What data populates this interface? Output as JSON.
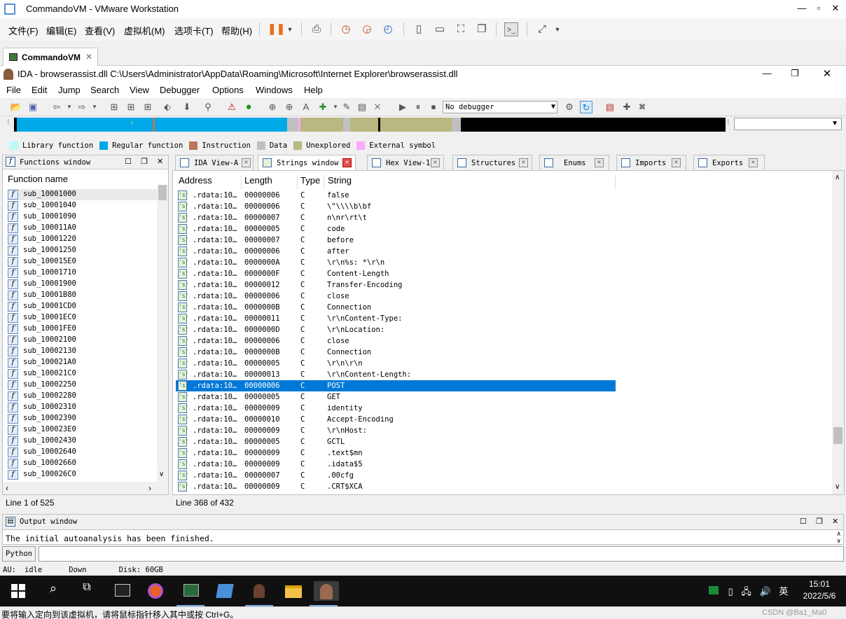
{
  "vmware": {
    "title": "CommandoVM - VMware Workstation",
    "menu": [
      "文件(F)",
      "编辑(E)",
      "查看(V)",
      "虚拟机(M)",
      "选项卡(T)",
      "帮助(H)"
    ],
    "tab": "CommandoVM",
    "status": "要将输入定向到该虚拟机，请将鼠标指针移入其中或按 Ctrl+G。",
    "watermark": "CSDN @Ba1_Ma0"
  },
  "ida": {
    "title": "IDA - browserassist.dll C:\\Users\\Administrator\\AppData\\Roaming\\Microsoft\\Internet Explorer\\browserassist.dll",
    "menu": [
      "File",
      "Edit",
      "Jump",
      "Search",
      "View",
      "Debugger",
      "Options",
      "Windows",
      "Help"
    ],
    "debugger": "No debugger",
    "legend": [
      {
        "label": "Library function",
        "color": "#c0f8f8"
      },
      {
        "label": "Regular function",
        "color": "#00a8e8"
      },
      {
        "label": "Instruction",
        "color": "#b87858"
      },
      {
        "label": "Data",
        "color": "#c0c0c0"
      },
      {
        "label": "Unexplored",
        "color": "#b8b880"
      },
      {
        "label": "External symbol",
        "color": "#ffa8ff"
      }
    ],
    "tabs": [
      "IDA View-A",
      "Strings window",
      "Hex View-1",
      "Structures",
      "Enums",
      "Imports",
      "Exports"
    ],
    "functions": {
      "title": "Functions window",
      "column": "Function name",
      "items": [
        "sub_10001000",
        "sub_10001040",
        "sub_10001090",
        "sub_100011A0",
        "sub_10001220",
        "sub_10001250",
        "sub_100015E0",
        "sub_10001710",
        "sub_10001900",
        "sub_10001B80",
        "sub_10001CD0",
        "sub_10001EC0",
        "sub_10001FE0",
        "sub_10002100",
        "sub_10002130",
        "sub_100021A0",
        "sub_100021C0",
        "sub_10002250",
        "sub_10002280",
        "sub_10002310",
        "sub_10002390",
        "sub_100023E0",
        "sub_10002430",
        "sub_10002640",
        "sub_10002660",
        "sub_100026C0"
      ],
      "status": "Line 1 of 525"
    },
    "strings": {
      "columns": [
        "Address",
        "Length",
        "Type",
        "String"
      ],
      "rows": [
        {
          "a": ".rdata:10…",
          "l": "00000006",
          "t": "C",
          "s": "false"
        },
        {
          "a": ".rdata:10…",
          "l": "00000006",
          "t": "C",
          "s": "\\\"\\\\\\\\b\\bf"
        },
        {
          "a": ".rdata:10…",
          "l": "00000007",
          "t": "C",
          "s": "n\\nr\\rt\\t"
        },
        {
          "a": ".rdata:10…",
          "l": "00000005",
          "t": "C",
          "s": "code"
        },
        {
          "a": ".rdata:10…",
          "l": "00000007",
          "t": "C",
          "s": "before"
        },
        {
          "a": ".rdata:10…",
          "l": "00000006",
          "t": "C",
          "s": "after"
        },
        {
          "a": ".rdata:10…",
          "l": "0000000A",
          "t": "C",
          "s": "\\r\\n%s: *\\r\\n"
        },
        {
          "a": ".rdata:10…",
          "l": "0000000F",
          "t": "C",
          "s": "Content-Length"
        },
        {
          "a": ".rdata:10…",
          "l": "00000012",
          "t": "C",
          "s": "Transfer-Encoding"
        },
        {
          "a": ".rdata:10…",
          "l": "00000006",
          "t": "C",
          "s": "close"
        },
        {
          "a": ".rdata:10…",
          "l": "0000000B",
          "t": "C",
          "s": "Connection"
        },
        {
          "a": ".rdata:10…",
          "l": "00000011",
          "t": "C",
          "s": "\\r\\nContent-Type:"
        },
        {
          "a": ".rdata:10…",
          "l": "0000000D",
          "t": "C",
          "s": "\\r\\nLocation:"
        },
        {
          "a": ".rdata:10…",
          "l": "00000006",
          "t": "C",
          "s": "close"
        },
        {
          "a": ".rdata:10…",
          "l": "0000000B",
          "t": "C",
          "s": "Connection"
        },
        {
          "a": ".rdata:10…",
          "l": "00000005",
          "t": "C",
          "s": "\\r\\n\\r\\n"
        },
        {
          "a": ".rdata:10…",
          "l": "00000013",
          "t": "C",
          "s": "\\r\\nContent-Length:"
        },
        {
          "a": ".rdata:10…",
          "l": "00000006",
          "t": "C",
          "s": "POST",
          "selected": true
        },
        {
          "a": ".rdata:10…",
          "l": "00000005",
          "t": "C",
          "s": "GET"
        },
        {
          "a": ".rdata:10…",
          "l": "00000009",
          "t": "C",
          "s": "identity"
        },
        {
          "a": ".rdata:10…",
          "l": "00000010",
          "t": "C",
          "s": "Accept-Encoding"
        },
        {
          "a": ".rdata:10…",
          "l": "00000009",
          "t": "C",
          "s": "\\r\\nHost:"
        },
        {
          "a": ".rdata:10…",
          "l": "00000005",
          "t": "C",
          "s": "GCTL"
        },
        {
          "a": ".rdata:10…",
          "l": "00000009",
          "t": "C",
          "s": ".text$mn"
        },
        {
          "a": ".rdata:10…",
          "l": "00000009",
          "t": "C",
          "s": ".idata$5"
        },
        {
          "a": ".rdata:10…",
          "l": "00000007",
          "t": "C",
          "s": ".00cfg"
        },
        {
          "a": ".rdata:10…",
          "l": "00000009",
          "t": "C",
          "s": ".CRT$XCA"
        }
      ],
      "status": "Line 368 of 432"
    },
    "output": {
      "title": "Output window",
      "text": "The initial autoanalysis has been finished.",
      "python_label": "Python"
    },
    "statusbar": {
      "au": "AU:",
      "state": "idle",
      "dir": "Down",
      "disk": "Disk: 60GB"
    }
  },
  "taskbar": {
    "time": "15:01",
    "date": "2022/5/6",
    "ime": "英"
  }
}
